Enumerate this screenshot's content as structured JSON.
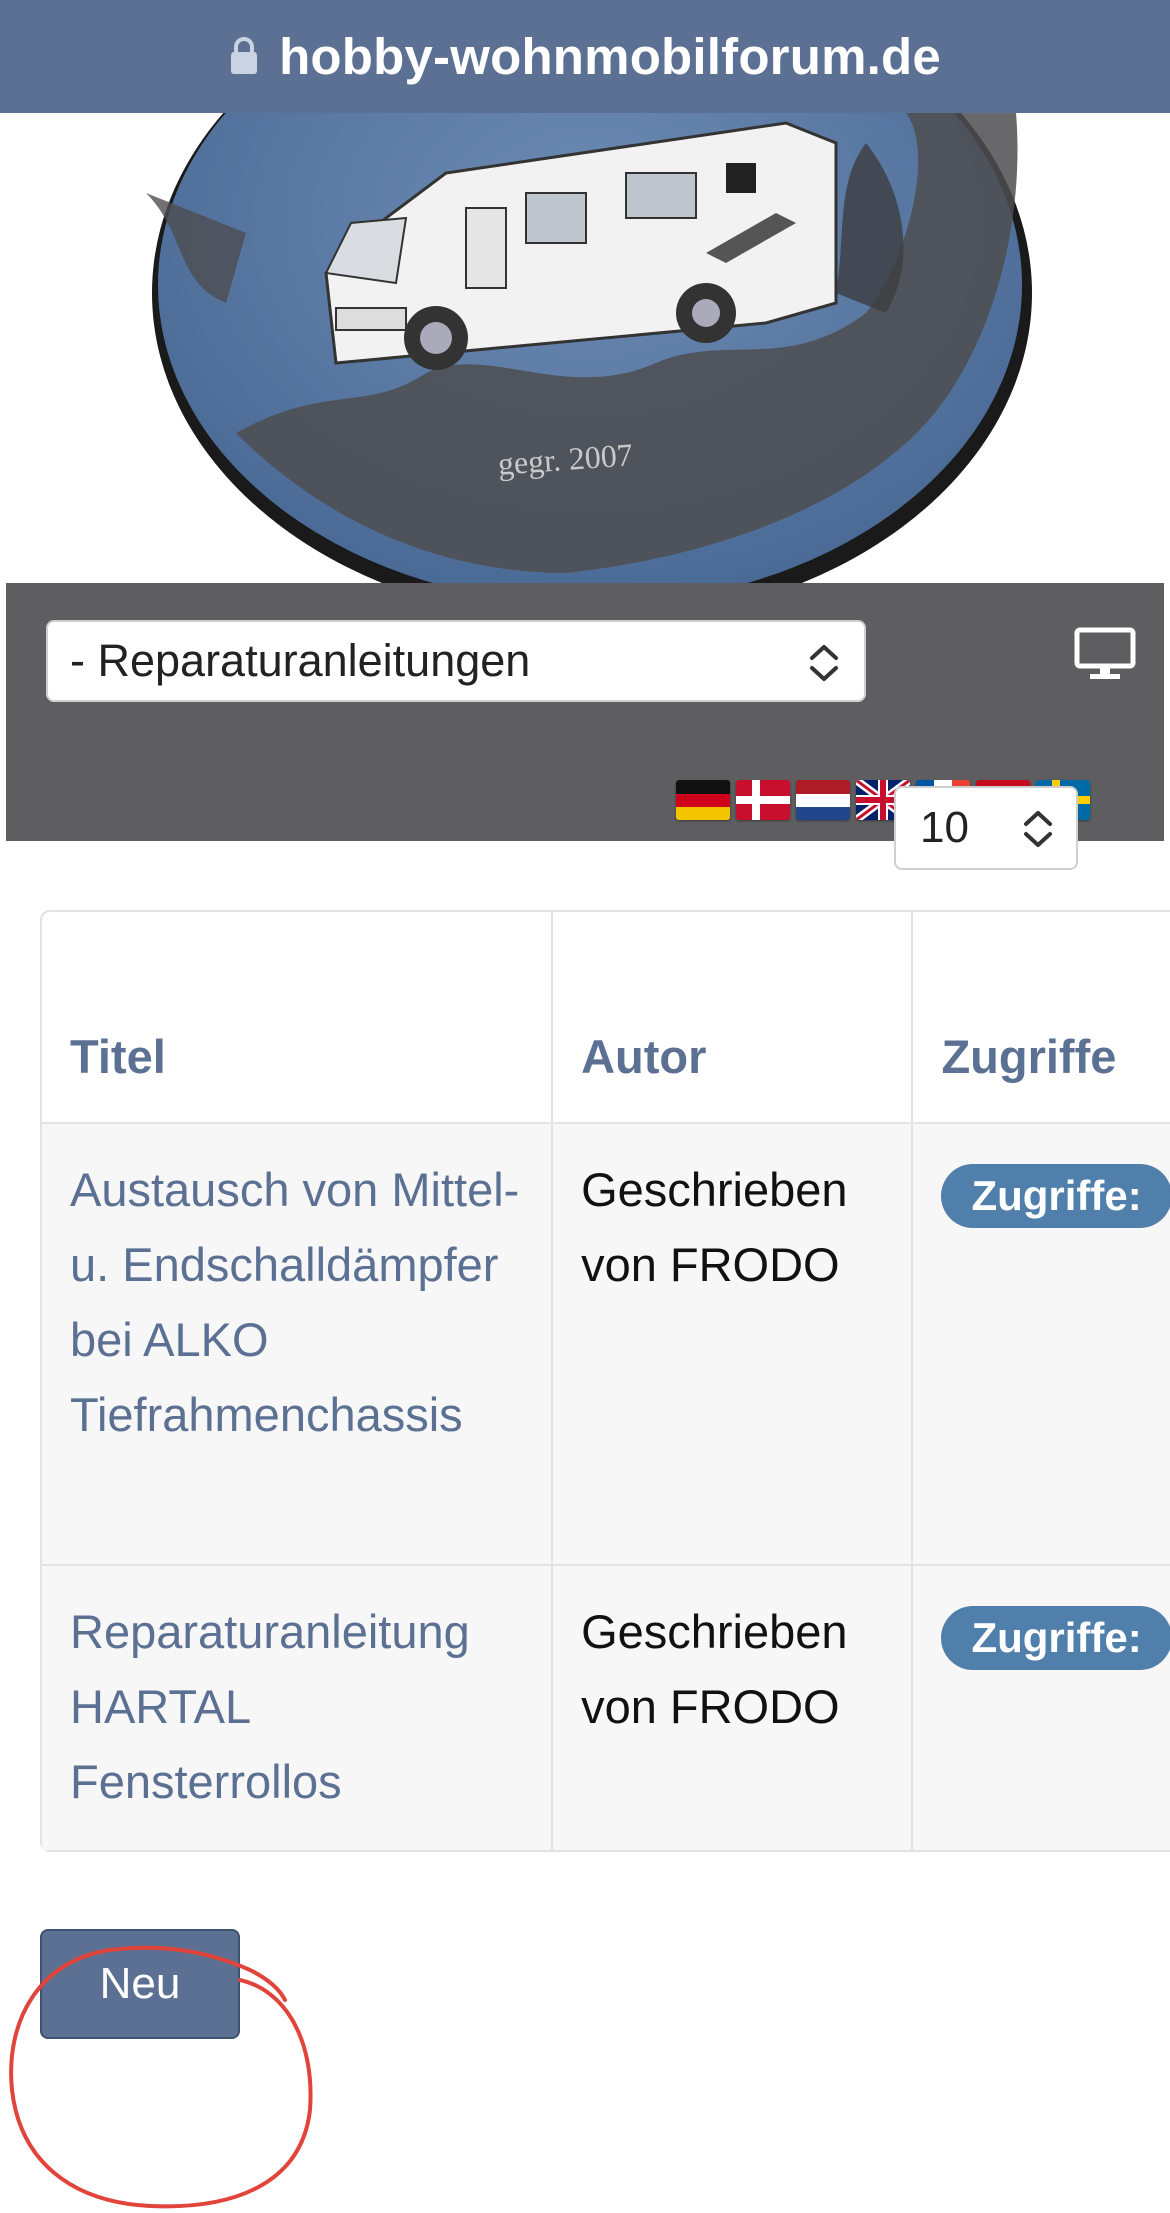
{
  "browser": {
    "url": "hobby-wohnmobilforum.de",
    "lock_icon": "lock-icon"
  },
  "logo": {
    "founded_text": "gegr. 2007"
  },
  "header": {
    "category_select_value": "- Reparaturanleitungen",
    "desktop_icon": "monitor-icon",
    "languages": [
      "de",
      "dk",
      "nl",
      "gb",
      "fr",
      "es",
      "se"
    ]
  },
  "list": {
    "per_page_value": "10",
    "columns": [
      "Titel",
      "Autor",
      "Zugriffe"
    ],
    "rows": [
      {
        "title": "Austausch von Mittel- u. Endschalldämpfer bei ALKO Tiefrahmenchassis",
        "author": "Geschrieben von FRODO",
        "hits_badge": "Zugriffe:"
      },
      {
        "title": "Reparaturanleitung HARTAL Fensterrollos",
        "author": "Geschrieben von FRODO",
        "hits_badge": "Zugriffe:"
      }
    ],
    "new_button_label": "Neu"
  },
  "colors": {
    "url_bar": "#5b7092",
    "band": "#5e5e60",
    "link": "#5b7092",
    "badge": "#4f7faa",
    "annotation": "#e0443a"
  }
}
